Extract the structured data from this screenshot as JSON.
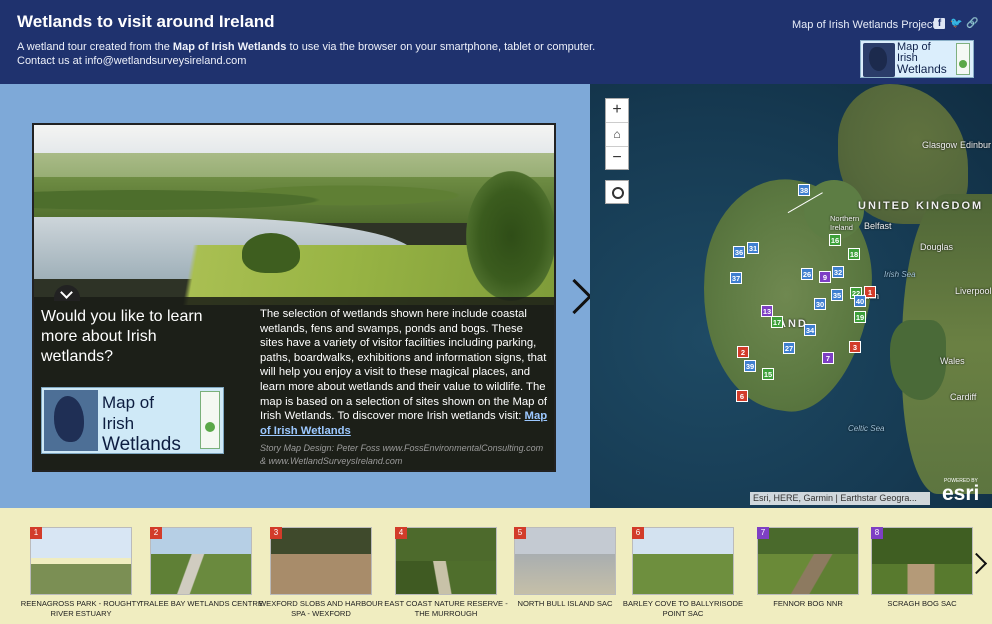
{
  "header": {
    "title": "Wetlands to visit around Ireland",
    "desc_prefix": "A wetland tour created from the ",
    "desc_bold": "Map of Irish Wetlands",
    "desc_suffix": " to use via the browser on your smartphone, tablet or computer.",
    "contact": "Contact us at info@wetlandsurveysireland.com",
    "project_link": "Map of Irish Wetlands Project",
    "share_icons": [
      "facebook-icon",
      "twitter-icon",
      "link-icon"
    ],
    "background_color": "#1f326e",
    "logo": {
      "line1": "Map of",
      "line2": "Irish",
      "line3": "Wetlands"
    }
  },
  "story": {
    "question": "Would you like to learn more about Irish wetlands?",
    "body": "The selection of wetlands shown here include coastal wetlands, fens and swamps, ponds and bogs. These sites have a variety of visitor facilities including parking, paths, boardwalks, exhibitions and information signs, that will help you enjoy a visit to these magical places, and learn more about wetlands and their value to wildlife. The map is based on a selection of sites shown on the Map of Irish Wetlands. To discover more Irish wetlands visit: ",
    "body_link": "Map of Irish Wetlands",
    "credit": "Story Map Design: Peter Foss www.FossEnvironmentalConsulting.com & www.WetlandSurveysIreland.com",
    "logo": {
      "line1": "Map of",
      "line2": "Irish",
      "line3": "Wetlands"
    },
    "panel_color": "#7ea9d8"
  },
  "map": {
    "zoom_in": "+",
    "zoom_out": "−",
    "home_icon": "home-icon",
    "locate_icon": "locate-icon",
    "labels": {
      "glasgow": "Glasgow",
      "edinburgh": "Edinbur",
      "uk": "UNITED KINGDOM",
      "northern_ireland": "Northern\nIreland",
      "belfast": "Belfast",
      "douglas": "Douglas",
      "irish_sea": "Irish Sea",
      "liverpool": "Liverpool",
      "wales": "Wales",
      "cardiff": "Cardiff",
      "celtic_sea": "Celtic Sea",
      "dublin": "ublin",
      "ireland": "AND"
    },
    "pins": [
      {
        "n": "38",
        "c": "blue"
      },
      {
        "n": "16",
        "c": "green"
      },
      {
        "n": "18",
        "c": "green"
      },
      {
        "n": "36",
        "c": "blue"
      },
      {
        "n": "31",
        "c": "blue"
      },
      {
        "n": "26",
        "c": "blue"
      },
      {
        "n": "9",
        "c": "purple"
      },
      {
        "n": "32",
        "c": "blue"
      },
      {
        "n": "37",
        "c": "blue"
      },
      {
        "n": "35",
        "c": "blue"
      },
      {
        "n": "22",
        "c": "green"
      },
      {
        "n": "1",
        "c": "red"
      },
      {
        "n": "30",
        "c": "blue"
      },
      {
        "n": "40",
        "c": "blue"
      },
      {
        "n": "13",
        "c": "purple"
      },
      {
        "n": "17",
        "c": "green"
      },
      {
        "n": "34",
        "c": "blue"
      },
      {
        "n": "19",
        "c": "green"
      },
      {
        "n": "27",
        "c": "blue"
      },
      {
        "n": "7",
        "c": "purple"
      },
      {
        "n": "3",
        "c": "red"
      },
      {
        "n": "2",
        "c": "red"
      },
      {
        "n": "39",
        "c": "blue"
      },
      {
        "n": "15",
        "c": "green"
      },
      {
        "n": "6",
        "c": "red"
      }
    ],
    "attribution": "Esri, HERE, Garmin | Earthstar Geogra...",
    "esri_powered": "POWERED BY",
    "esri": "esri"
  },
  "carousel": {
    "items": [
      {
        "n": "1",
        "color": "#d23c2a",
        "caption": "REENAGROSS PARK - ROUGHTY RIVER ESTUARY"
      },
      {
        "n": "2",
        "color": "#d23c2a",
        "caption": "TRALEE BAY WETLANDS CENTRE"
      },
      {
        "n": "3",
        "color": "#d23c2a",
        "caption": "WEXFORD SLOBS AND HARBOUR SPA - WEXFORD"
      },
      {
        "n": "4",
        "color": "#d23c2a",
        "caption": "EAST COAST NATURE RESERVE - THE MURROUGH"
      },
      {
        "n": "5",
        "color": "#d23c2a",
        "caption": "NORTH BULL ISLAND SAC"
      },
      {
        "n": "6",
        "color": "#d23c2a",
        "caption": "BARLEY COVE TO BALLYRISODE POINT SAC"
      },
      {
        "n": "7",
        "color": "#7e3fc4",
        "caption": "FENNOR BOG NNR"
      },
      {
        "n": "8",
        "color": "#7e3fc4",
        "caption": "SCRAGH BOG SAC"
      }
    ],
    "next_icon": "chevron-right-icon",
    "background_color": "#f0edc0"
  }
}
